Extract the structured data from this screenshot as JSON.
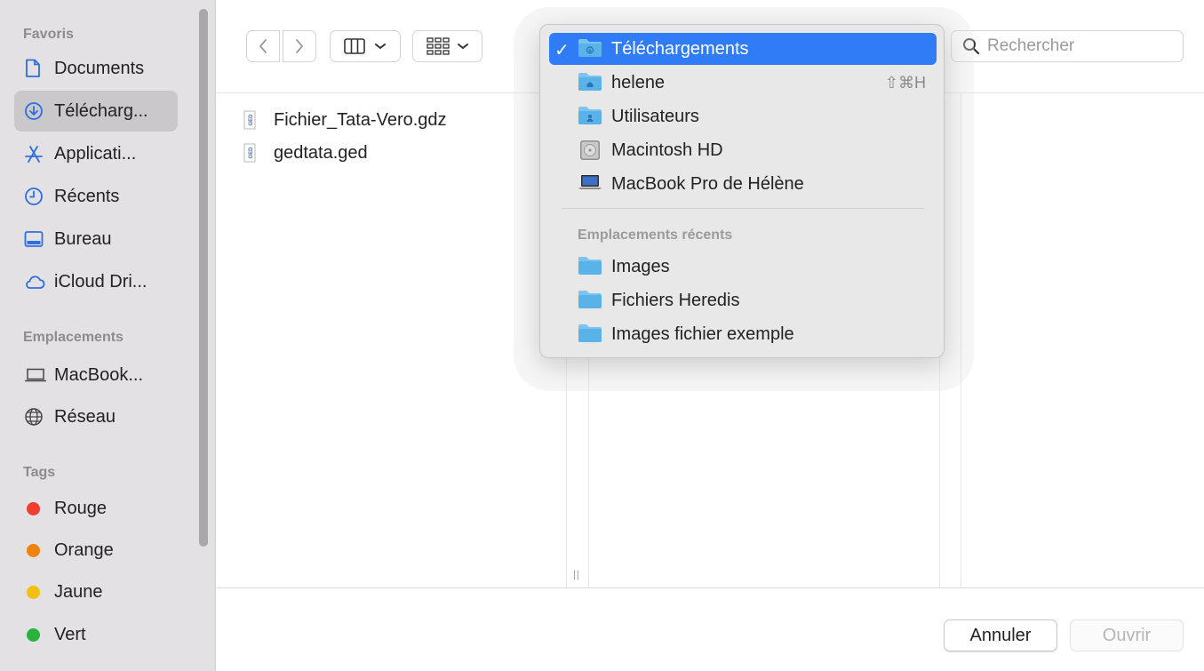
{
  "sidebar": {
    "favorites_title": "Favoris",
    "favorites": [
      {
        "label": "Documents",
        "icon": "document-icon"
      },
      {
        "label": "Télécharg...",
        "icon": "download-icon",
        "active": true
      },
      {
        "label": "Applicati...",
        "icon": "applications-icon"
      },
      {
        "label": "Récents",
        "icon": "clock-icon"
      },
      {
        "label": "Bureau",
        "icon": "desktop-icon"
      },
      {
        "label": "iCloud Dri...",
        "icon": "cloud-icon"
      }
    ],
    "locations_title": "Emplacements",
    "locations": [
      {
        "label": "MacBook...",
        "icon": "laptop-icon"
      },
      {
        "label": "Réseau",
        "icon": "globe-icon"
      }
    ],
    "tags_title": "Tags",
    "tags": [
      {
        "label": "Rouge",
        "color": "#f13d2f"
      },
      {
        "label": "Orange",
        "color": "#f0830f"
      },
      {
        "label": "Jaune",
        "color": "#f2c014"
      },
      {
        "label": "Vert",
        "color": "#29b33c"
      }
    ]
  },
  "toolbar": {
    "back_icon": "chevron-left-icon",
    "forward_icon": "chevron-right-icon",
    "view_icon": "columns-view-icon",
    "group_icon": "grid-icon",
    "search_placeholder": "Rechercher",
    "search_value": ""
  },
  "files": [
    {
      "name": "Fichier_Tata-Vero.gdz",
      "icon": "ged-file-icon"
    },
    {
      "name": "gedtata.ged",
      "icon": "ged-file-icon"
    }
  ],
  "location_menu": {
    "items": [
      {
        "label": "Téléchargements",
        "icon": "downloads-folder-icon",
        "checked": true,
        "selected": true
      },
      {
        "label": "helene",
        "icon": "home-folder-icon",
        "shortcut": "⇧⌘H"
      },
      {
        "label": "Utilisateurs",
        "icon": "users-folder-icon"
      },
      {
        "label": "Macintosh HD",
        "icon": "hard-drive-icon"
      },
      {
        "label": "MacBook Pro de Hélène",
        "icon": "laptop-icon"
      }
    ],
    "recent_title": "Emplacements récents",
    "recent_items": [
      {
        "label": "Images",
        "icon": "folder-icon"
      },
      {
        "label": "Fichiers Heredis",
        "icon": "folder-icon"
      },
      {
        "label": "Images fichier exemple",
        "icon": "folder-icon"
      }
    ]
  },
  "footer": {
    "cancel_label": "Annuler",
    "open_label": "Ouvrir"
  },
  "colors": {
    "accent": "#2f7cf6",
    "folder_blue": "#5ab3e8"
  }
}
